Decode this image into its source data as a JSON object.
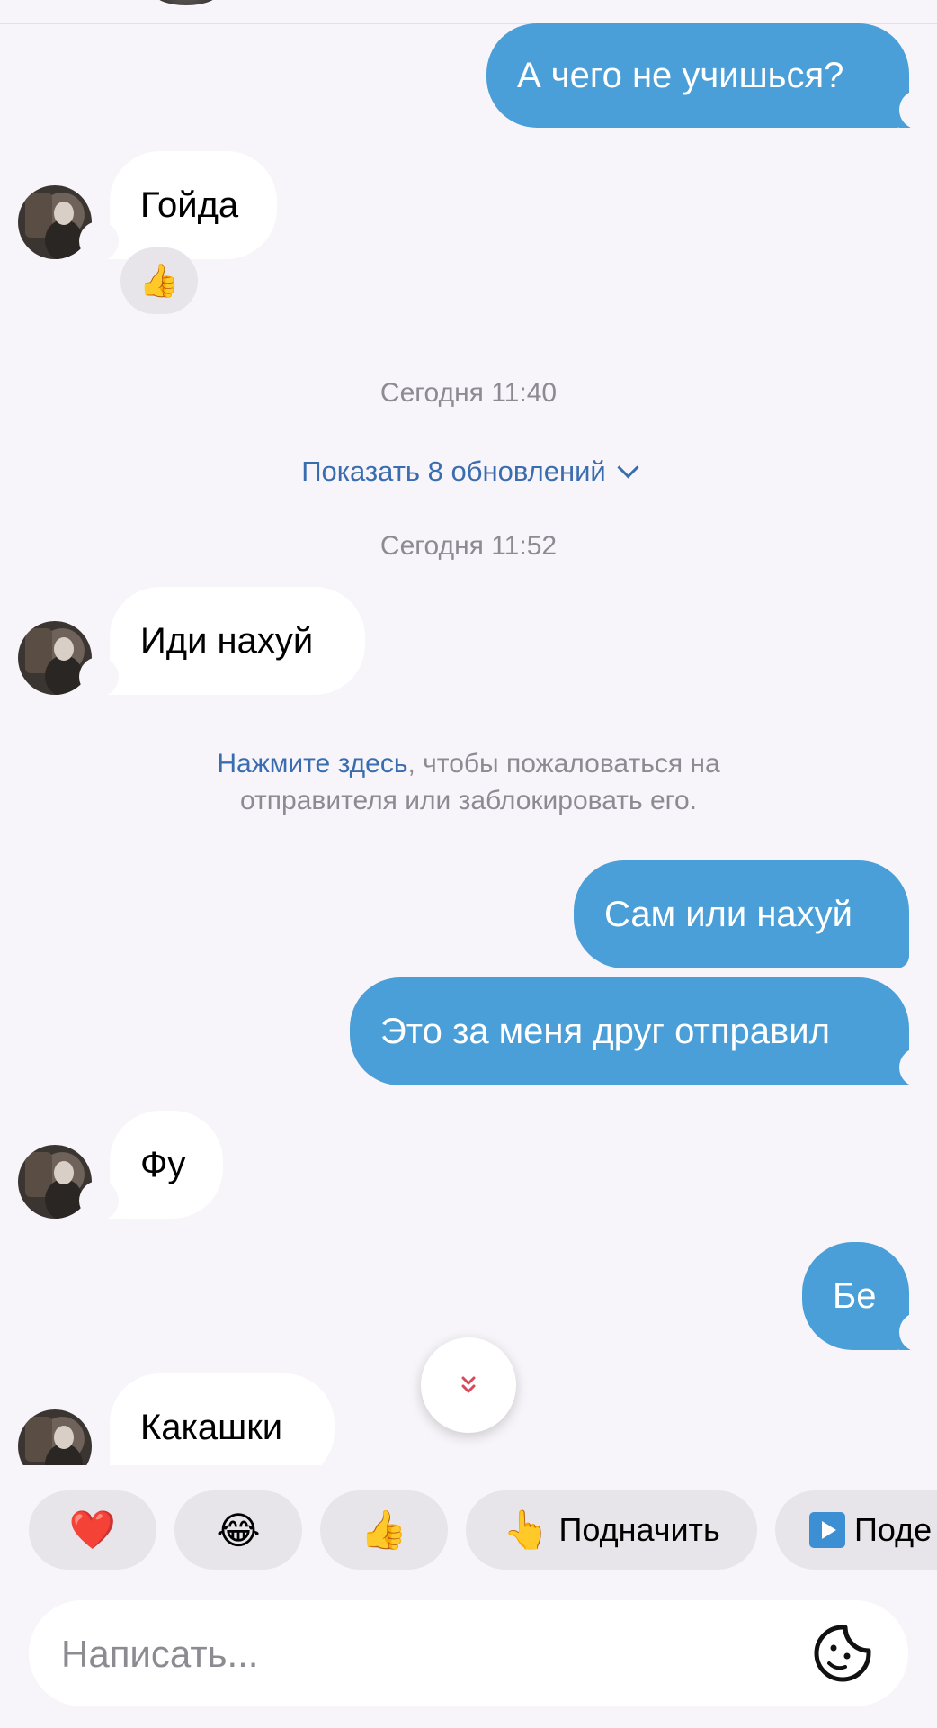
{
  "messages": [
    {
      "dir": "out",
      "text": "А чего не учишься?"
    },
    {
      "dir": "in",
      "text": "Гойда",
      "reaction": "👍"
    },
    {
      "dir": "in",
      "text": "Иди нахуй"
    },
    {
      "dir": "out",
      "text": "Сам или нахуй"
    },
    {
      "dir": "out",
      "text": "Это за меня друг отправил"
    },
    {
      "dir": "in",
      "text": "Фу"
    },
    {
      "dir": "out",
      "text": "Бе"
    },
    {
      "dir": "in",
      "text": "Какашки"
    }
  ],
  "date_separators": [
    "Сегодня 11:40",
    "Сегодня 11:52"
  ],
  "show_updates": "Показать 8 обновлений",
  "report_notice": {
    "link": "Нажмите здесь",
    "text_line1": ", чтобы пожаловаться на",
    "text_line2": "отправителя или заблокировать его."
  },
  "quick_reactions": [
    {
      "icon": "❤️"
    },
    {
      "icon": "😂"
    },
    {
      "icon": "👍"
    },
    {
      "icon": "👆",
      "label": "Подначить"
    },
    {
      "icon": "video-play-icon",
      "label": "Поде"
    }
  ],
  "composer": {
    "placeholder": "Написать..."
  },
  "colors": {
    "outgoing": "#4a9fd8",
    "incoming": "#ffffff",
    "background": "#f7f5f9",
    "link": "#3a6db0"
  }
}
